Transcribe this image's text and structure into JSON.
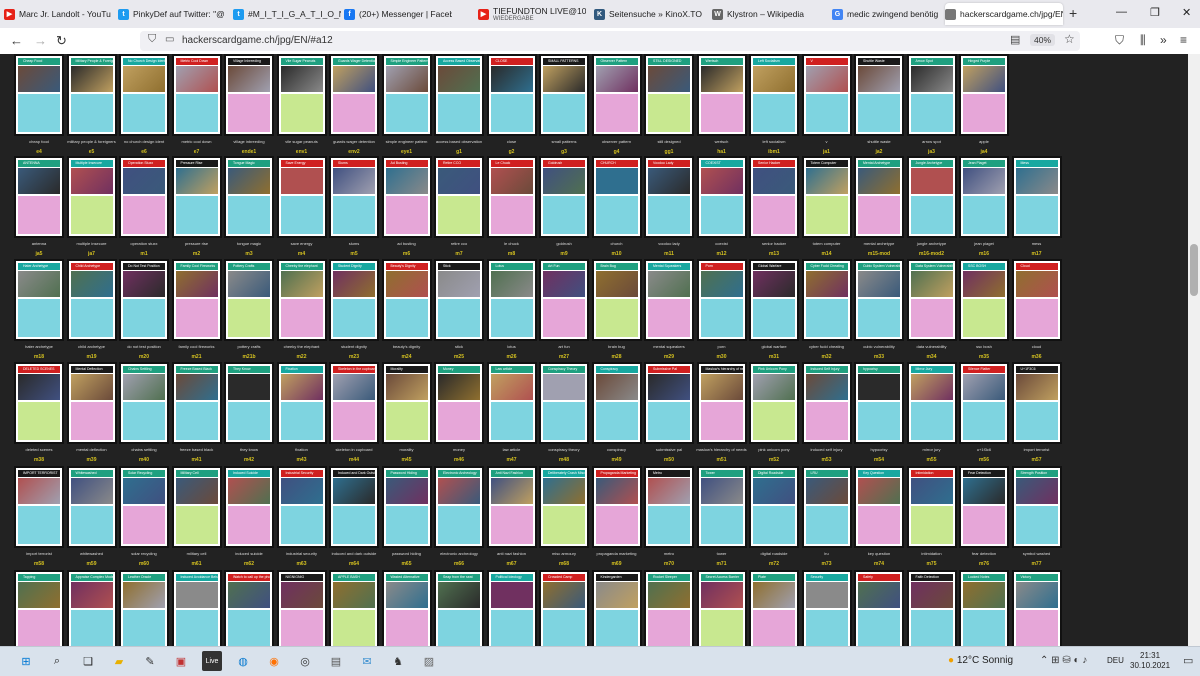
{
  "tabs": [
    {
      "title": "Marc Jr. Landolt - YouTu",
      "icon": "youtube-icon",
      "color": "#e62117",
      "glyph": "▶"
    },
    {
      "title": "PinkyDef auf Twitter: \"@",
      "icon": "twitter-icon",
      "color": "#1d9bf0",
      "glyph": "t"
    },
    {
      "title": "#M_I_T_I_G_A_T_I_O_N -",
      "icon": "twitter-icon",
      "color": "#1d9bf0",
      "glyph": "t"
    },
    {
      "title": "(20+) Messenger | Faceb",
      "icon": "facebook-icon",
      "color": "#1877f2",
      "glyph": "f"
    },
    {
      "title": "TIEFUNDTON LIVE@100",
      "subtitle": "WIEDERGABE",
      "icon": "youtube-icon",
      "color": "#e62117",
      "glyph": "▶"
    },
    {
      "title": "Seitensuche » KinoX.TO",
      "icon": "kinox-icon",
      "color": "#31597e",
      "glyph": "K"
    },
    {
      "title": "Klystron – Wikipedia",
      "icon": "wikipedia-icon",
      "color": "#666666",
      "glyph": "W"
    },
    {
      "title": "medic zwingend benötig",
      "icon": "google-icon",
      "color": "#4285f4",
      "glyph": "G"
    },
    {
      "title": "hackerscardgame.ch/jpg/EN",
      "icon": "page-icon",
      "color": "#777777",
      "glyph": ""
    }
  ],
  "nav": {
    "url": "hackerscardgame.ch/jpg/EN/#a12",
    "zoom": "40%"
  },
  "grid": {
    "rows": [
      {
        "codes": [
          "e4",
          "e5",
          "e6",
          "e7",
          "ende1",
          "env1",
          "env2",
          "eye1",
          "g1",
          "g2",
          "g3",
          "g4",
          "gg1",
          "ha1",
          "ibm1",
          "ja1",
          "ja2",
          "ja3",
          "ja4"
        ],
        "titles": [
          "Cheap Food",
          "Military People & Foreigners",
          "No Church Design Ident",
          "Metric Cool Down",
          "Village Inbreeding",
          "Vile Sugar Peanuts",
          "Guards Wager Detention",
          "Simple Engineer Pattern",
          "Access Based Observation",
          "CLOSE",
          "SMALL PATTERNS",
          "Observer Pattern",
          "STILL DESIGNED",
          "Wertsch",
          "Left Socialism",
          "V",
          "Shuttle Waste",
          "Arrow Spot",
          "Hinged Purple",
          "Apple",
          "Great Buster Gan"
        ],
        "captions": [
          "cheap food",
          "military people & foreigners",
          "no church design ident",
          "metric cool down",
          "village inbreeding",
          "vile sugar peanuts",
          "guards wager detention",
          "simple engineer pattern",
          "access based observation",
          "close",
          "small patterns",
          "observer pattern",
          "still designed",
          "wertsch",
          "left socialism",
          "v",
          "shuttle waste",
          "arrow spot",
          "apple"
        ]
      },
      {
        "codes": [
          "ja5",
          "ja7",
          "m1",
          "m2",
          "m3",
          "m4",
          "m5",
          "m6",
          "m7",
          "m8",
          "m9",
          "m10",
          "m11",
          "m12",
          "m13",
          "m14",
          "m15-mod",
          "m16-mod2",
          "m16",
          "m17"
        ],
        "titles": [
          "ANTENNA",
          "Multiple Insecure",
          "Operation Stuxx",
          "Pressure Rise",
          "Tongue Magic",
          "Save Energy",
          "Slums",
          "Ad Busting",
          "Retire CCO",
          "Le Chuck",
          "Goldrush",
          "CHURCH",
          "Voodoo Lady",
          "COEXIST",
          "Senior Hacker",
          "Totem Computer",
          "Mental Archetype",
          "Jungle Archetype",
          "Jean Piaget",
          "Mess"
        ],
        "captions": [
          "antenna",
          "multiple insecure",
          "operation stuxx",
          "pressure rise",
          "tongue magic",
          "save energy",
          "slums",
          "ad busting",
          "retire cco",
          "le chuck",
          "goldrush",
          "church",
          "voodoo lady",
          "coexist",
          "senior hacker",
          "totem computer",
          "mental archetype",
          "jungle archetype",
          "jean piaget",
          "mess"
        ]
      },
      {
        "codes": [
          "m18",
          "m19",
          "m20",
          "m21",
          "m21b",
          "m22",
          "m23",
          "m24",
          "m25",
          "m26",
          "m27",
          "m28",
          "m29",
          "m30",
          "m31",
          "m32",
          "m33",
          "m34",
          "m35",
          "m36"
        ],
        "titles": [
          "Hater Archetype",
          "Child Archetype",
          "Do Not Test Position",
          "Family Cool Fireworks",
          "Pottery Crafts",
          "Cheeky the elephant",
          "Student Dignity",
          "Beauty's Dignity",
          "Stick",
          "Lotus",
          "Art Fun",
          "Brain Bug",
          "Mental Squeakers",
          "Porn",
          "Global Warfare",
          "Cyber Fudd Cheating",
          "Cubic System Vulnerability",
          "Data System Vulnerability",
          "SSC BOSH",
          "Cloud"
        ],
        "captions": [
          "hater archetype",
          "child archetype",
          "do not test position",
          "family cool fireworks",
          "pottery crafts",
          "cheeky the elephant",
          "student dignity",
          "beauty's dignity",
          "stick",
          "lotus",
          "art fun",
          "brain bug",
          "mental squeakers",
          "porn",
          "global warfare",
          "cyber fudd cheating",
          "cubic vulnerability",
          "data vulnerability",
          "ssc bosh",
          "cloud"
        ]
      },
      {
        "codes": [
          "m38",
          "m39",
          "m40",
          "m41",
          "m42",
          "m43",
          "m44",
          "m45",
          "m46",
          "m47",
          "m48",
          "m49",
          "m50",
          "m51",
          "m52",
          "m53",
          "m54",
          "m55",
          "m56",
          "m57"
        ],
        "titles": [
          "DELETED SCENES",
          "Mental Deflection",
          "Chains Settling",
          "Freeze Based Black",
          "They Know",
          "Fixation",
          "Skeleton in the cupboard",
          "Morality",
          "Money",
          "Law article",
          "Conspiracy Theory",
          "Conspiracy",
          "Submissive Pal",
          "Maslow's hierarchy of needs",
          "Pink Unicorn Pony",
          "Induced Self Injury",
          "hypocrisy",
          "Mirror Jury",
          "Silence Flatter",
          "U+1F3C6",
          "IMPORT TERRORIST"
        ],
        "captions": [
          "deleted scenes",
          "mental deflection",
          "chains settling",
          "freeze based black",
          "they know",
          "fixation",
          "skeleton in cupboard",
          "morality",
          "money",
          "law article",
          "conspiracy theory",
          "conspiracy",
          "submissive pal",
          "maslow's hierarchy of needs",
          "pink unicorn pony",
          "induced self injury",
          "hypocrisy",
          "mirror jury",
          "u+1f3c6",
          "import terrorist"
        ]
      },
      {
        "codes": [
          "m58",
          "m59",
          "m60",
          "m61",
          "m62",
          "m63",
          "m64",
          "m65",
          "m66",
          "m67",
          "m68",
          "m69",
          "m70",
          "m71",
          "m72",
          "m73",
          "m74",
          "m75",
          "m76",
          "m77"
        ],
        "titles": [
          "IMPORT TERRORIST",
          "Whitewashed",
          "Solar Recycling",
          "Military Cell",
          "Induced Suicide",
          "Industrial Security",
          "Induced and Dark Outside",
          "Password Hiding",
          "Electronic Archeology",
          "Anti Nazi Fashion",
          "Deliberately Crash Misc Armoury",
          "Propaganda Marketing",
          "Metro",
          "Tower",
          "Digital Roadside",
          "LRU",
          "Key Question",
          "Intimidation",
          "Fear Detection",
          "Strength Position",
          "Symbol Washed"
        ],
        "captions": [
          "import terrorist",
          "whitewashed",
          "solar recycling",
          "military cell",
          "induced suicide",
          "industrial security",
          "induced and dark outside",
          "password hiding",
          "electronic archeology",
          "anti nazi fashion",
          "misc armoury",
          "propaganda marketing",
          "metro",
          "tower",
          "digital roadside",
          "lru",
          "key question",
          "intimidation",
          "fear detection",
          "symbol washed"
        ]
      },
      {
        "codes": [
          "m78",
          "m79",
          "m80",
          "m81",
          "m82",
          "m83",
          "m84",
          "m85",
          "m86",
          "m87",
          "m88",
          "m89",
          "m90",
          "m91",
          "m92",
          "m93",
          "m94",
          "m95",
          "m96",
          "m97"
        ],
        "titles": [
          "Tapping",
          "Appraise Complex Models",
          "Leather Oracle",
          "Induced Avoidance Behavior",
          "Watch to call up the phone",
          "NIGNIGNIG",
          "APPLE BASH",
          "Wasted Alternative",
          "Seap from the seat",
          "Political Ideology",
          "Crowded Camp",
          "Kindergarden",
          "Rocket Sleeper",
          "Secret Access Barrier",
          "Plate",
          "Security",
          "Safety",
          "Faith Detection",
          "Locked Notes",
          "Victory",
          "Unknown Plants"
        ],
        "captions": [
          "tapping",
          "appraise complex models",
          "leather oracle",
          "induced avoidance",
          "watch to call",
          "nignignig",
          "apple bash",
          "wasted alternative",
          "seap from the seat",
          "political ideology",
          "crowded camp",
          "kindergarden",
          "rocket sleeper",
          "secret access",
          "plate",
          "security",
          "safety",
          "faith detection",
          "locked notes",
          "unknown plants"
        ]
      }
    ]
  },
  "colors": {
    "header_green": "#1fa080",
    "header_red": "#d02020",
    "header_dark": "#1a1a1a",
    "header_teal": "#18a8a0",
    "text_cyan": "#7ed4e0",
    "text_pink": "#e6a6d8",
    "text_lime": "#c8e890",
    "code_yellow": "#d8c420"
  },
  "taskbar": {
    "weather": "12°C  Sonnig",
    "lang": "DEU",
    "time": "21:31",
    "date": "30.10.2021",
    "live_label": "Live",
    "icons": [
      "windows-icon",
      "search-icon",
      "task-view-icon",
      "file-explorer-icon",
      "pen-icon",
      "terminal-icon",
      "live-icon",
      "edge-icon",
      "firefox-icon",
      "obs-icon",
      "photos-icon",
      "chat-icon",
      "game-icon",
      "photo-icon"
    ]
  }
}
